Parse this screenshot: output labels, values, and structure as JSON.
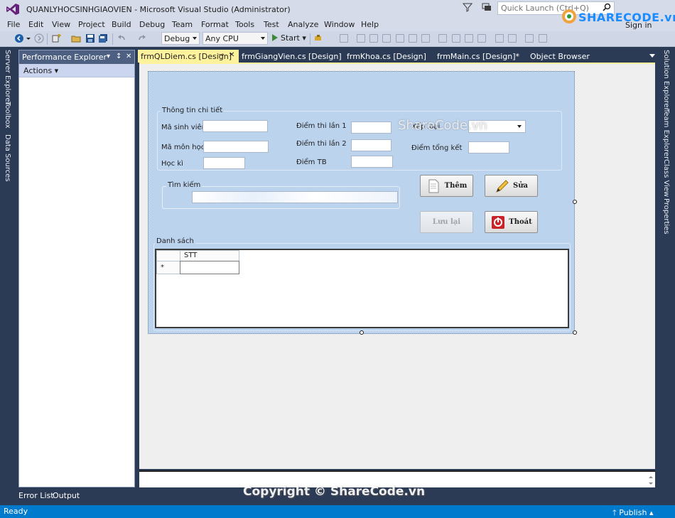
{
  "window": {
    "title": "QUANLYHOCSINHGIAOVIEN - Microsoft Visual Studio (Administrator)",
    "quick_launch_placeholder": "Quick Launch (Ctrl+Q)",
    "sign_in": "Sign in"
  },
  "watermark": {
    "logo_text": "SHARECODE.vn",
    "center_text": "ShareCode.vn",
    "copyright": "Copyright © ShareCode.vn"
  },
  "menu": [
    "File",
    "Edit",
    "View",
    "Project",
    "Build",
    "Debug",
    "Team",
    "Format",
    "Tools",
    "Test",
    "Analyze",
    "Window",
    "Help"
  ],
  "toolbar": {
    "config": "Debug",
    "platform": "Any CPU",
    "start_label": "Start"
  },
  "left_rail": [
    "Server Explorer",
    "Toolbox",
    "Data Sources"
  ],
  "right_rail": [
    "Solution Explorer",
    "Team Explorer",
    "Class View",
    "Properties"
  ],
  "perf_explorer": {
    "title": "Performance Explorer",
    "actions_label": "Actions",
    "pin": "↕",
    "close": "✕"
  },
  "doc_tabs": [
    {
      "label": "frmQLDiem.cs [Design]",
      "active": true
    },
    {
      "label": "frmGiangVien.cs [Design]",
      "active": false
    },
    {
      "label": "frmKhoa.cs [Design]",
      "active": false
    },
    {
      "label": "frmMain.cs [Design]*",
      "active": false
    },
    {
      "label": "Object Browser",
      "active": false
    }
  ],
  "form": {
    "group_detail_title": "Thông tin chi tiết",
    "labels": {
      "ma_sinh_vien": "Mã sinh viên",
      "ma_mon_hoc": "Mã môn học",
      "hoc_ki": "Học kì",
      "diem_thi_lan_1": "Điểm thi lần 1",
      "diem_thi_lan_2": "Điểm thi lần 2",
      "diem_tb": "Điểm TB",
      "xep_loai": "Xếp loại",
      "diem_tong_ket": "Điểm tổng kết"
    },
    "search_group_title": "Tìm kiếm",
    "list_group_title": "Danh sách",
    "buttons": {
      "them": "Thêm",
      "sua": "Sửa",
      "luu": "Lưu lại",
      "thoat": "Thoát"
    },
    "grid": {
      "columns": [
        "STT"
      ],
      "new_row_marker": "*"
    }
  },
  "bottom_tabs": [
    "Error List",
    "Output"
  ],
  "status": {
    "text": "Ready",
    "publish": "Publish"
  }
}
